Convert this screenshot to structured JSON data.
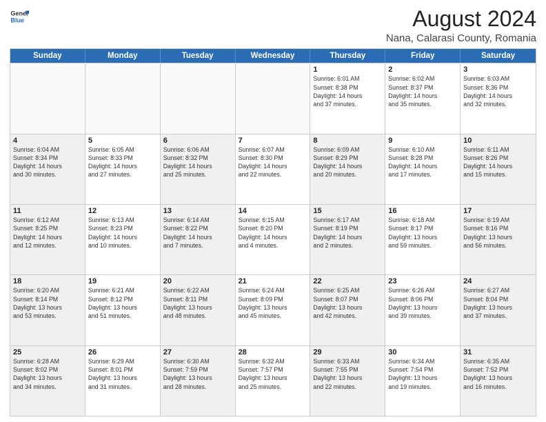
{
  "header": {
    "logo_general": "General",
    "logo_blue": "Blue",
    "month": "August 2024",
    "location": "Nana, Calarasi County, Romania"
  },
  "weekdays": [
    "Sunday",
    "Monday",
    "Tuesday",
    "Wednesday",
    "Thursday",
    "Friday",
    "Saturday"
  ],
  "rows": [
    [
      {
        "day": "",
        "info": "",
        "empty": true
      },
      {
        "day": "",
        "info": "",
        "empty": true
      },
      {
        "day": "",
        "info": "",
        "empty": true
      },
      {
        "day": "",
        "info": "",
        "empty": true
      },
      {
        "day": "1",
        "info": "Sunrise: 6:01 AM\nSunset: 8:38 PM\nDaylight: 14 hours\nand 37 minutes."
      },
      {
        "day": "2",
        "info": "Sunrise: 6:02 AM\nSunset: 8:37 PM\nDaylight: 14 hours\nand 35 minutes."
      },
      {
        "day": "3",
        "info": "Sunrise: 6:03 AM\nSunset: 8:36 PM\nDaylight: 14 hours\nand 32 minutes."
      }
    ],
    [
      {
        "day": "4",
        "info": "Sunrise: 6:04 AM\nSunset: 8:34 PM\nDaylight: 14 hours\nand 30 minutes.",
        "shaded": true
      },
      {
        "day": "5",
        "info": "Sunrise: 6:05 AM\nSunset: 8:33 PM\nDaylight: 14 hours\nand 27 minutes."
      },
      {
        "day": "6",
        "info": "Sunrise: 6:06 AM\nSunset: 8:32 PM\nDaylight: 14 hours\nand 25 minutes.",
        "shaded": true
      },
      {
        "day": "7",
        "info": "Sunrise: 6:07 AM\nSunset: 8:30 PM\nDaylight: 14 hours\nand 22 minutes."
      },
      {
        "day": "8",
        "info": "Sunrise: 6:09 AM\nSunset: 8:29 PM\nDaylight: 14 hours\nand 20 minutes.",
        "shaded": true
      },
      {
        "day": "9",
        "info": "Sunrise: 6:10 AM\nSunset: 8:28 PM\nDaylight: 14 hours\nand 17 minutes."
      },
      {
        "day": "10",
        "info": "Sunrise: 6:11 AM\nSunset: 8:26 PM\nDaylight: 14 hours\nand 15 minutes.",
        "shaded": true
      }
    ],
    [
      {
        "day": "11",
        "info": "Sunrise: 6:12 AM\nSunset: 8:25 PM\nDaylight: 14 hours\nand 12 minutes.",
        "shaded": true
      },
      {
        "day": "12",
        "info": "Sunrise: 6:13 AM\nSunset: 8:23 PM\nDaylight: 14 hours\nand 10 minutes."
      },
      {
        "day": "13",
        "info": "Sunrise: 6:14 AM\nSunset: 8:22 PM\nDaylight: 14 hours\nand 7 minutes.",
        "shaded": true
      },
      {
        "day": "14",
        "info": "Sunrise: 6:15 AM\nSunset: 8:20 PM\nDaylight: 14 hours\nand 4 minutes."
      },
      {
        "day": "15",
        "info": "Sunrise: 6:17 AM\nSunset: 8:19 PM\nDaylight: 14 hours\nand 2 minutes.",
        "shaded": true
      },
      {
        "day": "16",
        "info": "Sunrise: 6:18 AM\nSunset: 8:17 PM\nDaylight: 13 hours\nand 59 minutes."
      },
      {
        "day": "17",
        "info": "Sunrise: 6:19 AM\nSunset: 8:16 PM\nDaylight: 13 hours\nand 56 minutes.",
        "shaded": true
      }
    ],
    [
      {
        "day": "18",
        "info": "Sunrise: 6:20 AM\nSunset: 8:14 PM\nDaylight: 13 hours\nand 53 minutes.",
        "shaded": true
      },
      {
        "day": "19",
        "info": "Sunrise: 6:21 AM\nSunset: 8:12 PM\nDaylight: 13 hours\nand 51 minutes."
      },
      {
        "day": "20",
        "info": "Sunrise: 6:22 AM\nSunset: 8:11 PM\nDaylight: 13 hours\nand 48 minutes.",
        "shaded": true
      },
      {
        "day": "21",
        "info": "Sunrise: 6:24 AM\nSunset: 8:09 PM\nDaylight: 13 hours\nand 45 minutes."
      },
      {
        "day": "22",
        "info": "Sunrise: 6:25 AM\nSunset: 8:07 PM\nDaylight: 13 hours\nand 42 minutes.",
        "shaded": true
      },
      {
        "day": "23",
        "info": "Sunrise: 6:26 AM\nSunset: 8:06 PM\nDaylight: 13 hours\nand 39 minutes."
      },
      {
        "day": "24",
        "info": "Sunrise: 6:27 AM\nSunset: 8:04 PM\nDaylight: 13 hours\nand 37 minutes.",
        "shaded": true
      }
    ],
    [
      {
        "day": "25",
        "info": "Sunrise: 6:28 AM\nSunset: 8:02 PM\nDaylight: 13 hours\nand 34 minutes.",
        "shaded": true
      },
      {
        "day": "26",
        "info": "Sunrise: 6:29 AM\nSunset: 8:01 PM\nDaylight: 13 hours\nand 31 minutes."
      },
      {
        "day": "27",
        "info": "Sunrise: 6:30 AM\nSunset: 7:59 PM\nDaylight: 13 hours\nand 28 minutes.",
        "shaded": true
      },
      {
        "day": "28",
        "info": "Sunrise: 6:32 AM\nSunset: 7:57 PM\nDaylight: 13 hours\nand 25 minutes."
      },
      {
        "day": "29",
        "info": "Sunrise: 6:33 AM\nSunset: 7:55 PM\nDaylight: 13 hours\nand 22 minutes.",
        "shaded": true
      },
      {
        "day": "30",
        "info": "Sunrise: 6:34 AM\nSunset: 7:54 PM\nDaylight: 13 hours\nand 19 minutes."
      },
      {
        "day": "31",
        "info": "Sunrise: 6:35 AM\nSunset: 7:52 PM\nDaylight: 13 hours\nand 16 minutes.",
        "shaded": true
      }
    ]
  ]
}
